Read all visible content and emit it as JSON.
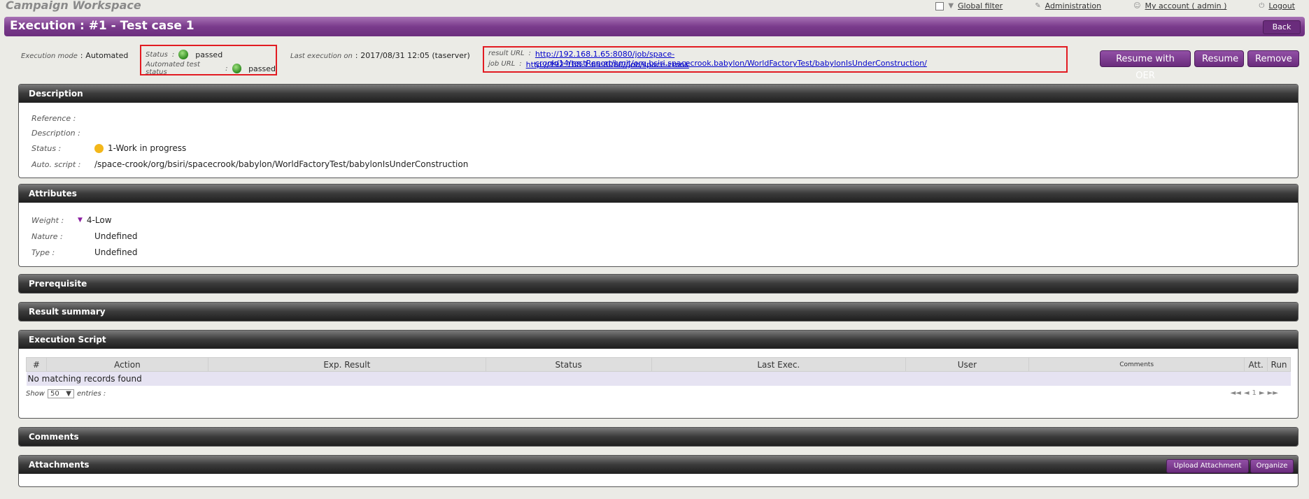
{
  "workspace_title": "Campaign Workspace",
  "top_menu": {
    "global_filter": "Global filter",
    "administration": "Administration",
    "my_account": "My account  ( admin )",
    "logout": "Logout"
  },
  "execution": {
    "title": "Execution : #1 - Test case 1",
    "back_label": "Back"
  },
  "info": {
    "mode_label": "Execution mode",
    "mode_sep": ":",
    "mode_value": "Automated",
    "status_label": "Status",
    "status_value": "passed",
    "auto_status_label": "Automated test status",
    "auto_status_value": "passed",
    "last_exec_label": "Last execution on",
    "last_exec_value": "2017/08/31 12:05 (taserver)",
    "result_url_label": "result URL",
    "result_url": "http://192.168.1.65:8080/job/space-crook/14/testReport/junit/org.bsiri.spacecrook.babylon/WorldFactoryTest/babylonIsUnderConstruction/",
    "job_url_label": "job URL",
    "job_url": "http://192.168.1.65:8080//job/space-crook",
    "colon": ":"
  },
  "actions": {
    "resume_oer": "Resume with OER",
    "resume": "Resume",
    "remove": "Remove"
  },
  "description": {
    "header": "Description",
    "reference_label": "Reference :",
    "reference_value": "",
    "description_label": "Description :",
    "description_value": "",
    "status_label": "Status :",
    "status_value": "1-Work in progress",
    "script_label": "Auto. script :",
    "script_value": "/space-crook/org/bsiri/spacecrook/babylon/WorldFactoryTest/babylonIsUnderConstruction"
  },
  "attributes": {
    "header": "Attributes",
    "weight_label": "Weight :",
    "weight_value": "4-Low",
    "nature_label": "Nature :",
    "nature_value": "Undefined",
    "type_label": "Type :",
    "type_value": "Undefined"
  },
  "sections": {
    "prerequisite": "Prerequisite",
    "result_summary": "Result summary",
    "execution_script": "Execution Script",
    "comments": "Comments",
    "attachments": "Attachments"
  },
  "script_table": {
    "columns": [
      "#",
      "Action",
      "Exp. Result",
      "Status",
      "Last Exec.",
      "User",
      "Comments",
      "Att.",
      "Run"
    ],
    "empty": "No matching records found",
    "show": "Show",
    "entries_value": "50",
    "entries": "entries :",
    "pager_first": "◄◄",
    "pager_prev": "◄",
    "pager_page": "1",
    "pager_next": "►",
    "pager_last": "►►"
  },
  "attachments": {
    "upload": "Upload Attachment",
    "organize": "Organize"
  },
  "colors": {
    "accent": "#7a3b8c",
    "highlight": "#e21b22",
    "passed": "#2f8b1f",
    "in_progress": "#f3b71a"
  }
}
